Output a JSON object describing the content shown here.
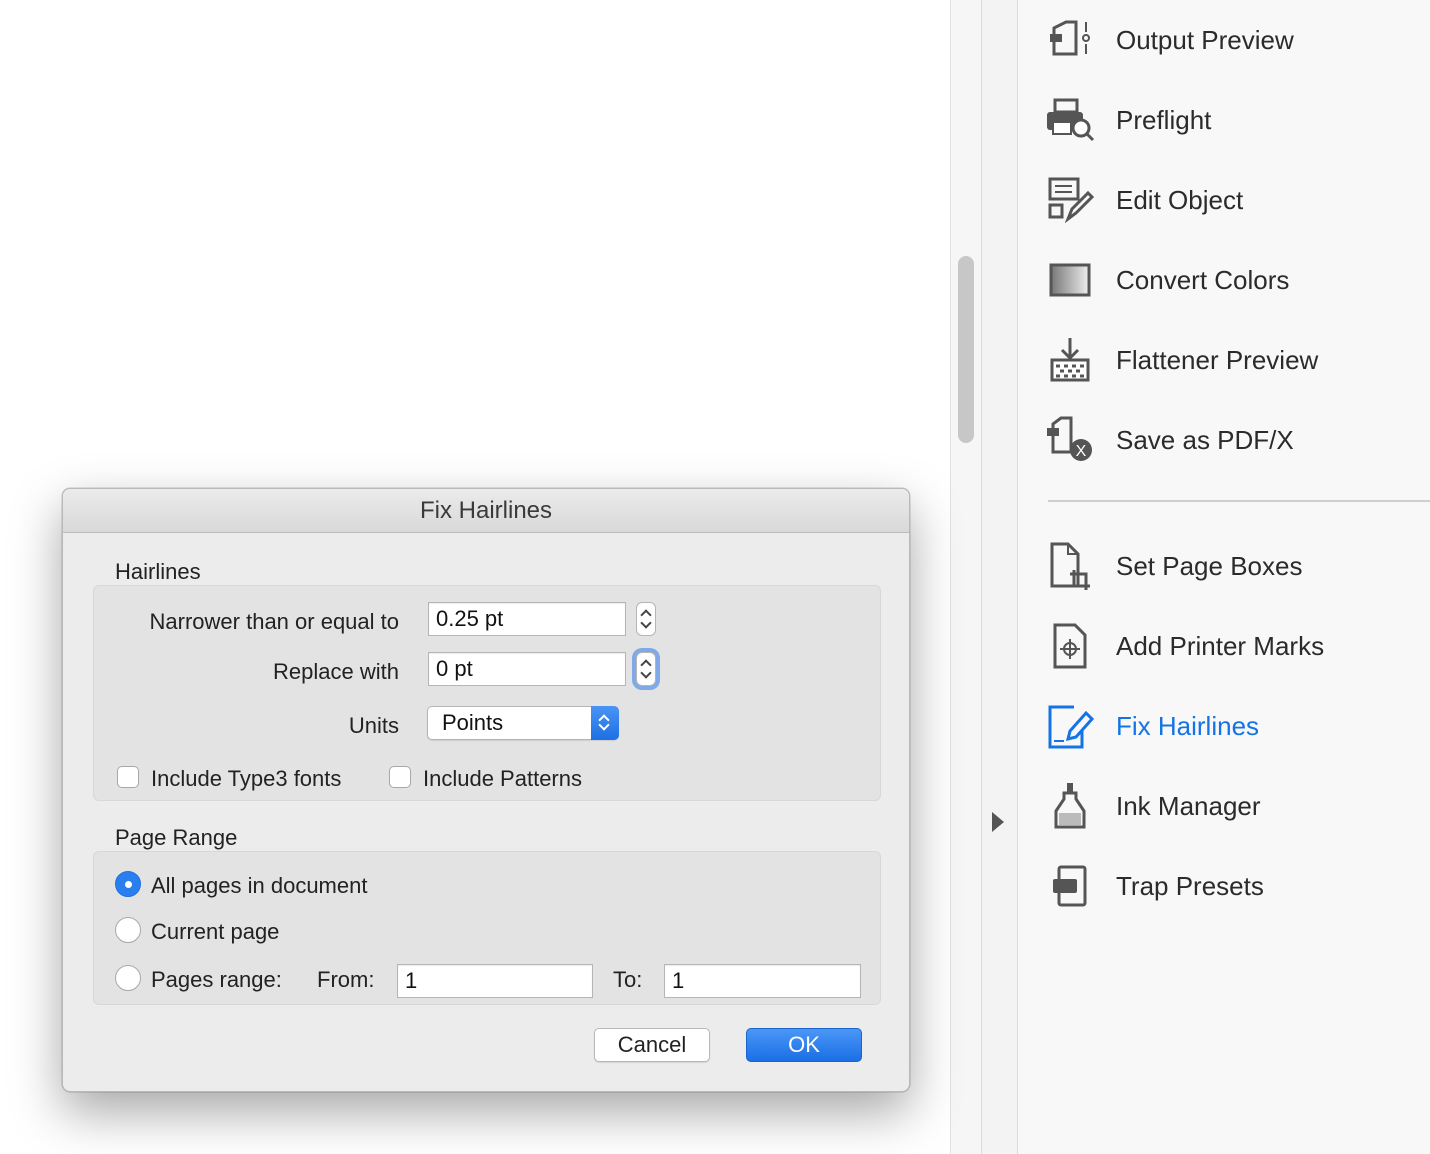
{
  "dialog": {
    "title": "Fix Hairlines",
    "hairlines": {
      "section_title": "Hairlines",
      "narrower_label": "Narrower than or equal to",
      "narrower_value": "0.25 pt",
      "replace_label": "Replace with",
      "replace_value": "0 pt",
      "units_label": "Units",
      "units_value": "Points",
      "include_type3_label": "Include Type3 fonts",
      "include_type3_checked": false,
      "include_patterns_label": "Include Patterns",
      "include_patterns_checked": false
    },
    "page_range": {
      "section_title": "Page Range",
      "all_pages_label": "All pages in document",
      "current_page_label": "Current page",
      "pages_range_label": "Pages range:",
      "from_label": "From:",
      "from_value": "1",
      "to_label": "To:",
      "to_value": "1",
      "selected": "all_pages"
    },
    "buttons": {
      "cancel": "Cancel",
      "ok": "OK"
    }
  },
  "tools_panel": {
    "accent_color": "#1473e6",
    "group1": [
      {
        "label": "Output Preview",
        "icon": "output-preview-icon"
      },
      {
        "label": "Preflight",
        "icon": "preflight-icon"
      },
      {
        "label": "Edit Object",
        "icon": "edit-object-icon"
      },
      {
        "label": "Convert Colors",
        "icon": "convert-colors-icon"
      },
      {
        "label": "Flattener Preview",
        "icon": "flattener-preview-icon"
      },
      {
        "label": "Save as PDF/X",
        "icon": "save-pdfx-icon"
      }
    ],
    "group2": [
      {
        "label": "Set Page Boxes",
        "icon": "set-page-boxes-icon"
      },
      {
        "label": "Add Printer Marks",
        "icon": "printer-marks-icon"
      },
      {
        "label": "Fix Hairlines",
        "icon": "fix-hairlines-icon",
        "active": true
      },
      {
        "label": "Ink Manager",
        "icon": "ink-manager-icon"
      },
      {
        "label": "Trap Presets",
        "icon": "trap-presets-icon"
      }
    ]
  }
}
